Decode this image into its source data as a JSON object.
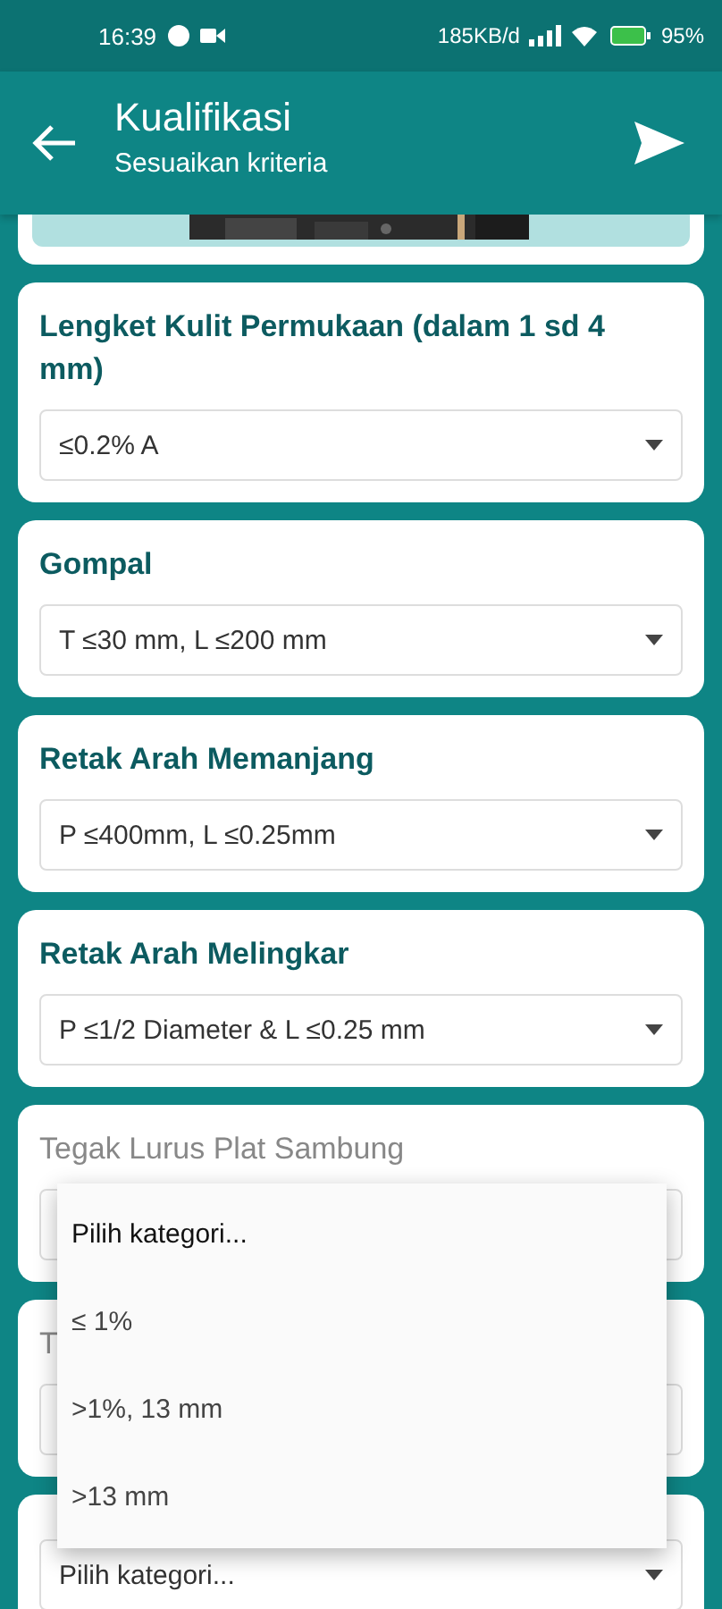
{
  "status_bar": {
    "time": "16:39",
    "speed": "185KB/d",
    "battery": "95%"
  },
  "app_bar": {
    "title": "Kualifikasi",
    "subtitle": "Sesuaikan kriteria"
  },
  "criteria": [
    {
      "title": "Lengket Kulit Permukaan (dalam 1 sd 4 mm)",
      "answered": true,
      "value": "≤0.2% A"
    },
    {
      "title": "Gompal",
      "answered": true,
      "value": "T ≤30 mm, L ≤200 mm"
    },
    {
      "title": "Retak Arah Memanjang",
      "answered": true,
      "value": "P ≤400mm, L ≤0.25mm"
    },
    {
      "title": "Retak Arah Melingkar",
      "answered": true,
      "value": "P ≤1/2 Diameter & L ≤0.25 mm"
    },
    {
      "title": "Tegak Lurus Plat Sambung",
      "answered": false
    },
    {
      "title": "T",
      "answered": false
    },
    {
      "value": "Pilih kategori..."
    }
  ],
  "dropdown_menu": {
    "options": [
      "Pilih kategori...",
      "≤ 1%",
      ">1%, 13 mm",
      ">13 mm"
    ]
  }
}
